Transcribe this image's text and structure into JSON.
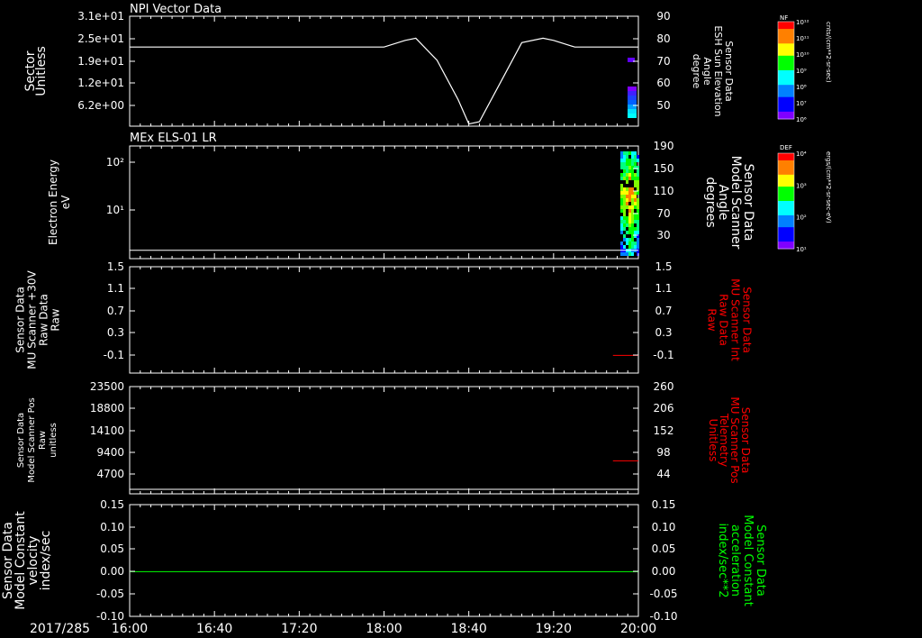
{
  "colors": {
    "background": "#000000",
    "foreground": "#ffffff",
    "red": "#ff0000",
    "green": "#00ff00"
  },
  "chart_data": [
    {
      "type": "line",
      "title": "NPI Vector Data",
      "left_axis": {
        "label_lines": [
          "Sector",
          "Unitless"
        ],
        "ticks": [
          "3.1e+01",
          "2.5e+01",
          "1.9e+01",
          "1.2e+01",
          "6.2e+00"
        ]
      },
      "right_axis": {
        "label_lines": [
          "Sensor Data",
          "ESH Sun Elevation",
          "Angle",
          "degree"
        ],
        "ticks": [
          "90",
          "80",
          "70",
          "60",
          "50"
        ],
        "ylim": [
          40,
          90
        ]
      },
      "series": [
        {
          "name": "ESH Sun Elevation Angle",
          "x": [
            "16:00",
            "17:00",
            "18:00",
            "18:10",
            "18:15",
            "18:25",
            "18:35",
            "18:40",
            "18:45",
            "18:55",
            "19:05",
            "19:15",
            "19:20",
            "19:30",
            "20:00"
          ],
          "y": [
            76,
            76,
            76,
            79,
            80,
            70,
            52,
            41,
            42,
            60,
            78,
            80,
            79,
            76,
            76
          ]
        }
      ],
      "colorbar": {
        "label": "NF",
        "units": "cnts/(cm**2-sr-sec)",
        "ticks": [
          "10¹²",
          "10¹¹",
          "10¹⁰",
          "10⁹",
          "10⁸",
          "10⁷",
          "10⁶"
        ]
      }
    },
    {
      "type": "heatmap",
      "title": "MEx ELS-01 LR",
      "left_axis": {
        "label_lines": [
          "Electron Energy",
          "eV"
        ],
        "ticks": [
          "10²",
          "10¹"
        ],
        "scale": "log"
      },
      "right_axis": {
        "label_lines": [
          "Sensor Data",
          "Model Scanner",
          "Angle",
          "degrees"
        ],
        "ticks": [
          "190",
          "150",
          "110",
          "70",
          "30"
        ],
        "ylim": [
          0,
          190
        ]
      },
      "series": [
        {
          "name": "Model Scanner Angle",
          "x": [
            "16:00",
            "20:00"
          ],
          "y": [
            14,
            14
          ]
        }
      ],
      "colorbar": {
        "label": "DEF",
        "units": "ergs/(cm**2-sr-sec-eV)",
        "ticks": [
          "10⁴",
          "10³",
          "10²",
          "10¹"
        ]
      }
    },
    {
      "type": "line",
      "left_axis": {
        "label_lines": [
          "Sensor Data",
          "MU Scanner +30V",
          "Raw Data",
          "Raw"
        ],
        "ticks": [
          "1.5",
          "1.1",
          "0.7",
          "0.3",
          "-0.1"
        ],
        "ylim": [
          -0.3,
          1.5
        ]
      },
      "right_axis": {
        "label_lines": [
          "Sensor Data",
          "MU Scanner Int",
          "Raw Data",
          "Raw"
        ],
        "ticks": [
          "1.5",
          "1.1",
          "0.7",
          "0.3",
          "-0.1"
        ],
        "ylim": [
          -0.3,
          1.5
        ]
      },
      "series": [
        {
          "name": "MU Scanner Int Raw Data",
          "color": "#ff0000",
          "x": [
            "19:48",
            "20:00"
          ],
          "y": [
            0.0,
            0.0
          ]
        }
      ]
    },
    {
      "type": "line",
      "left_axis": {
        "label_lines": [
          "Sensor Data",
          "Model Scanner Pos",
          "Raw",
          "unitless"
        ],
        "ticks": [
          "23500",
          "18800",
          "14100",
          "9400",
          "4700"
        ],
        "ylim": [
          0,
          23500
        ]
      },
      "right_axis": {
        "label_lines": [
          "Sensor Data",
          "MU Scanner Pos",
          "Telemetry",
          "Unitless"
        ],
        "ticks": [
          "260",
          "206",
          "152",
          "98",
          "44"
        ],
        "ylim": [
          0,
          260
        ]
      },
      "series": [
        {
          "name": "MU Scanner Pos Telemetry",
          "color": "#ff0000",
          "x": [
            "19:48",
            "20:00"
          ],
          "y": [
            80,
            80
          ]
        },
        {
          "name": "Model Scanner Pos Raw",
          "x": [
            "16:00",
            "20:00"
          ],
          "y": [
            0,
            0
          ]
        }
      ]
    },
    {
      "type": "line",
      "left_axis": {
        "label_lines": [
          "Sensor Data",
          "Model Constant",
          "velocity",
          "index/sec"
        ],
        "ticks": [
          "0.15",
          "0.10",
          "0.05",
          "0.00",
          "-0.05",
          "-0.10"
        ],
        "ylim": [
          -0.1,
          0.15
        ]
      },
      "right_axis": {
        "label_lines": [
          "Sensor Data",
          "Model Constant",
          "acceleration",
          "index/sec**2"
        ],
        "ticks": [
          "0.15",
          "0.10",
          "0.05",
          "0.00",
          "-0.05",
          "-0.10"
        ],
        "ylim": [
          -0.1,
          0.15
        ]
      },
      "series": [
        {
          "name": "Model Constant velocity",
          "color": "#00ff00",
          "x": [
            "16:00",
            "20:00"
          ],
          "y": [
            0.0,
            0.0
          ]
        }
      ]
    }
  ],
  "x_axis": {
    "date": "2017/285",
    "ticks": [
      "16:00",
      "16:40",
      "17:20",
      "18:00",
      "18:40",
      "19:20",
      "20:00"
    ]
  }
}
